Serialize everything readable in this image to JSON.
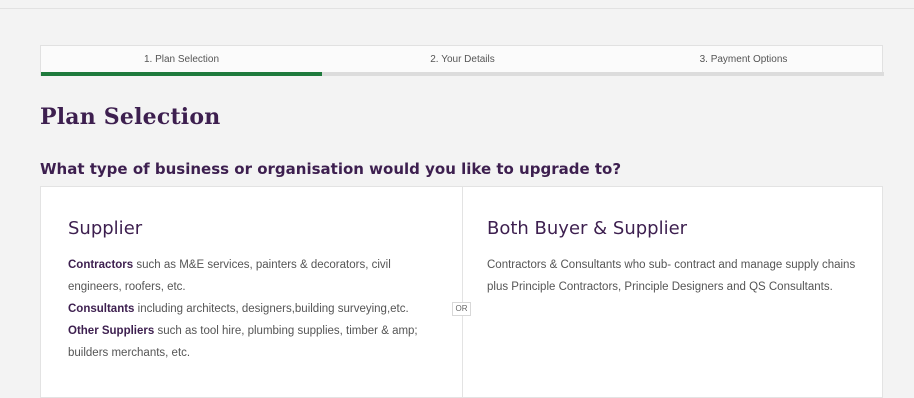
{
  "steps": [
    {
      "label": "1. Plan Selection",
      "active": true
    },
    {
      "label": "2. Your Details",
      "active": false
    },
    {
      "label": "3. Payment Options",
      "active": false
    }
  ],
  "progress_fraction": 0.333,
  "page_title": "Plan Selection",
  "question": "What type of business or organisation would you like to upgrade to?",
  "supplier": {
    "title": "Supplier",
    "contractors_label": "Contractors",
    "contractors_text": " such as M&E services, painters & decorators, civil engineers, roofers, etc.",
    "consultants_label": "Consultants",
    "consultants_text": " including architects, designers,building surveying,etc.",
    "other_label": "Other Suppliers",
    "other_text": " such as tool hire, plumbing supplies, timber & amp; builders merchants, etc."
  },
  "or_label": "OR",
  "both": {
    "title": "Both Buyer & Supplier",
    "text": "Contractors & Consultants who sub- contract and manage supply chains plus Principle Contractors, Principle Designers and QS Consultants."
  },
  "colors": {
    "accent": "#1e7a3c",
    "heading": "#3d1f4f"
  }
}
